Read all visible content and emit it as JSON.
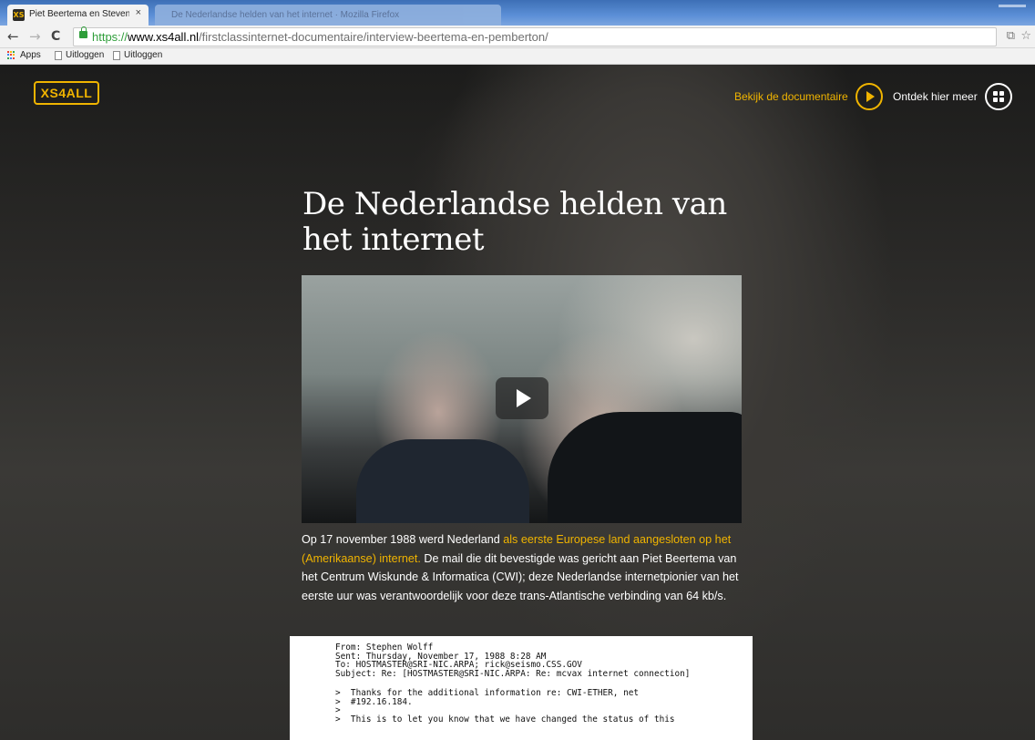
{
  "browser": {
    "active_tab": {
      "favicon": "XS",
      "title": "Piet Beertema en Steven P",
      "close": "×"
    },
    "inactive_tabs": {
      "text": "De Nederlandse helden van het internet · Mozilla Firefox"
    },
    "nav": {
      "back": "←",
      "forward": "→",
      "reload": "C"
    },
    "url": {
      "scheme": "https://",
      "host": "www.xs4all.nl",
      "path": "/firstclassinternet-documentaire/interview-beertema-en-pemberton/"
    },
    "toolbar_icons": {
      "translate": "⧉",
      "star": "☆"
    },
    "bookmarks": [
      {
        "label": "Apps"
      },
      {
        "label": "Uitloggen"
      },
      {
        "label": "Uitloggen"
      }
    ],
    "apps_grid_colors": [
      "#ea4335",
      "#fbbc05",
      "#34a853",
      "#4285f4",
      "#ea4335",
      "#fbbc05",
      "#34a853",
      "#4285f4",
      "#ea4335"
    ]
  },
  "page": {
    "logo": "XS4ALL",
    "nav": {
      "documentary": "Bekijk de documentaire",
      "more": "Ontdek hier meer"
    },
    "headline": "De Nederlandse helden van het internet",
    "video": {
      "play_icon": "play-icon"
    },
    "intro": {
      "before": "Op 17 november 1988 werd Nederland ",
      "highlight": "als eerste Europese land aangesloten op het (Amerikaanse) internet.",
      "after": " De mail die dit bevestigde was gericht aan Piet Beertema van het Centrum Wiskunde & Informatica (CWI); deze Nederlandse internetpionier van het eerste uur was verantwoordelijk voor deze trans-Atlantische verbinding van 64 kb/s."
    },
    "mail": {
      "header": [
        "From: Stephen Wolff",
        "Sent: Thursday, November 17, 1988 8:28 AM",
        "To: HOSTMASTER@SRI-NIC.ARPA; rick@seismo.CSS.GOV",
        "Subject: Re: [HOSTMASTER@SRI-NIC.ARPA: Re: mcvax internet connection]"
      ],
      "body": [
        ">  Thanks for the additional information re: CWI-ETHER, net",
        ">  #192.16.184.",
        ">",
        ">  This is to let you know that we have changed the status of this"
      ]
    },
    "colors": {
      "accent": "#f0b400",
      "text": "#ffffff"
    }
  }
}
